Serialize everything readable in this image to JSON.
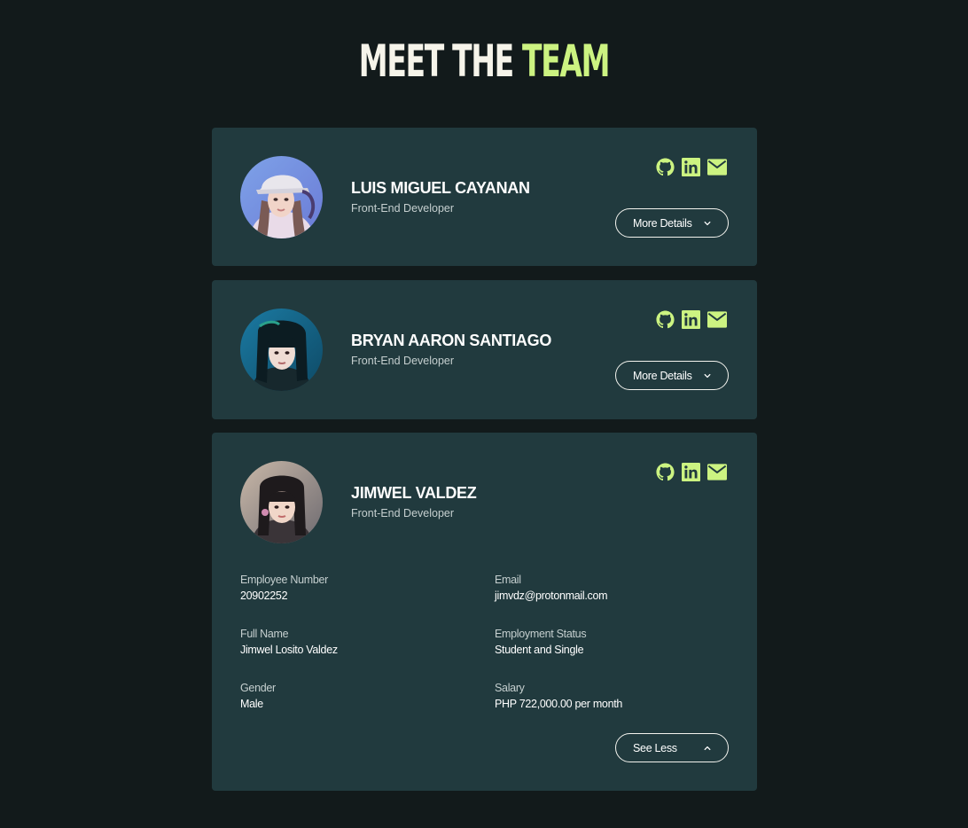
{
  "header": {
    "title_part1": "MEET THE",
    "title_part2": "TEAM",
    "accent_color": "#ccf381"
  },
  "members": [
    {
      "name": "LUIS MIGUEL CAYANAN",
      "role": "Front-End Developer",
      "button_label": "More Details",
      "button_icon": "chevron-down-icon",
      "expanded": false
    },
    {
      "name": "BRYAN AARON SANTIAGO",
      "role": "Front-End Developer",
      "button_label": "More Details",
      "button_icon": "chevron-down-icon",
      "expanded": false
    },
    {
      "name": "JIMWEL VALDEZ",
      "role": "Front-End Developer",
      "button_label": "See Less",
      "button_icon": "chevron-up-icon",
      "expanded": true,
      "details": {
        "employee_number_label": "Employee Number",
        "employee_number": "20902252",
        "email_label": "Email",
        "email": "jimvdz@protonmail.com",
        "full_name_label": "Full Name",
        "full_name": "Jimwel Losito Valdez",
        "employment_status_label": "Employment Status",
        "employment_status": "Student and Single",
        "gender_label": "Gender",
        "gender": "Male",
        "salary_label": "Salary",
        "salary": "PHP 722,000.00 per month"
      }
    }
  ],
  "social_icons": [
    "github-icon",
    "linkedin-icon",
    "mail-icon"
  ],
  "colors": {
    "background": "#121a1b",
    "card": "#213a3e",
    "accent": "#ccf381",
    "text": "#ffffff",
    "muted_text": "#c5cfcf"
  }
}
